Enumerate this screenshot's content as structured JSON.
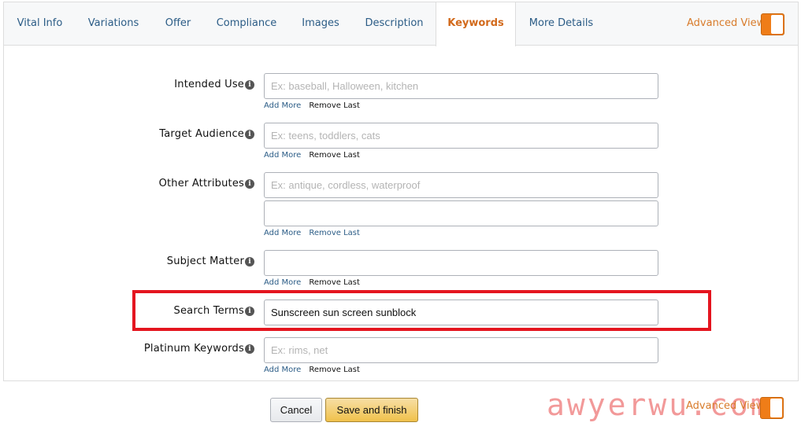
{
  "tabs": [
    {
      "label": "Vital Info"
    },
    {
      "label": "Variations"
    },
    {
      "label": "Offer"
    },
    {
      "label": "Compliance"
    },
    {
      "label": "Images"
    },
    {
      "label": "Description"
    },
    {
      "label": "Keywords"
    },
    {
      "label": "More Details"
    }
  ],
  "active_tab": "Keywords",
  "advanced_view": {
    "label": "Advanced View"
  },
  "fields": {
    "intended_use": {
      "label": "Intended Use",
      "placeholder": "Ex: baseball, Halloween, kitchen",
      "value": ""
    },
    "target_audience": {
      "label": "Target Audience",
      "placeholder": "Ex: teens, toddlers, cats",
      "value": ""
    },
    "other_attributes": {
      "label": "Other Attributes",
      "placeholder": "Ex: antique, cordless, waterproof",
      "value": "",
      "value2": ""
    },
    "subject_matter": {
      "label": "Subject Matter",
      "placeholder": "",
      "value": ""
    },
    "search_terms": {
      "label": "Search Terms",
      "placeholder": "",
      "value": "Sunscreen sun screen sunblock"
    },
    "platinum_keywords": {
      "label": "Platinum Keywords",
      "placeholder": "Ex: rims, net",
      "value": ""
    }
  },
  "links": {
    "add_more": "Add More",
    "remove_last": "Remove Last"
  },
  "info_glyph": "i",
  "buttons": {
    "cancel": "Cancel",
    "save": "Save and finish"
  },
  "footer_advanced_view": "Advanced View",
  "watermark": "awyerwu.com",
  "colors": {
    "accent": "#d26a1c",
    "link": "#2b5c86",
    "highlight": "#e4151f",
    "toggle": "#ef7d18"
  }
}
